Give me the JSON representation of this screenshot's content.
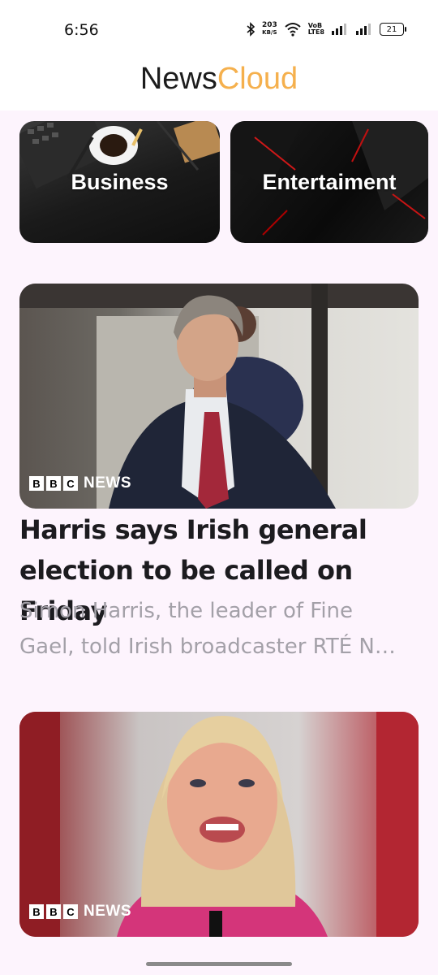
{
  "status_bar": {
    "time": "6:56",
    "speed_value": "203",
    "speed_unit": "KB/S",
    "volte_top": "VoB",
    "volte_bottom": "LTE8",
    "battery": "21",
    "icons": [
      "bluetooth-icon",
      "wifi-icon",
      "signal-icon",
      "signal-icon",
      "battery-icon"
    ]
  },
  "app": {
    "title_part1": "News",
    "title_part2": "Cloud",
    "accent": "#f5b04d"
  },
  "categories": [
    {
      "label": "Business"
    },
    {
      "label": "Entertaiment"
    }
  ],
  "articles": [
    {
      "source_boxes": [
        "B",
        "B",
        "C"
      ],
      "source_word": "NEWS",
      "headline": "Harris says Irish general election to be called on Friday",
      "description": "Simon Harris, the leader of Fine Gael, told Irish broadcaster RTÉ N…"
    },
    {
      "source_boxes": [
        "B",
        "B",
        "C"
      ],
      "source_word": "NEWS"
    }
  ]
}
